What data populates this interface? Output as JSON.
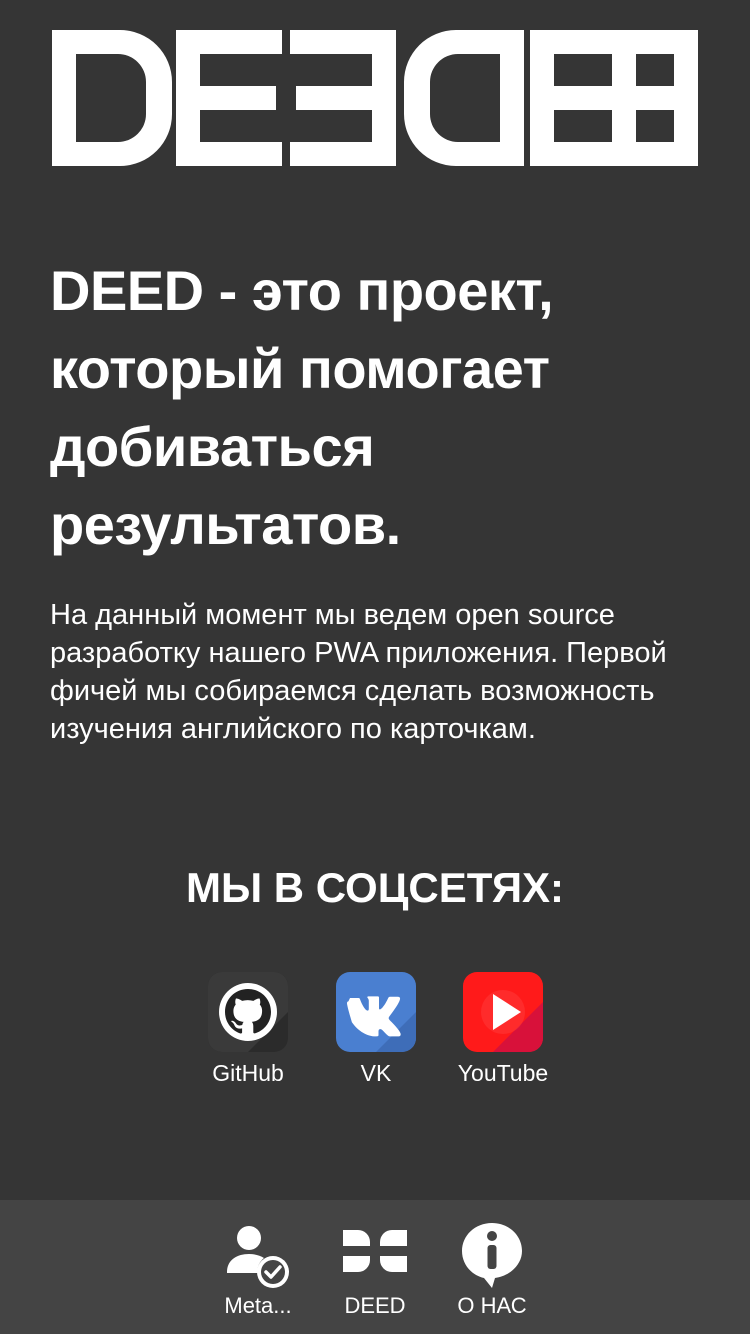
{
  "logo": {
    "text": "DEED",
    "color": "#ffffff"
  },
  "headline": "DEED - это проект, который помогает добиваться результатов.",
  "intro": "На данный момент мы ведем open source разработку нашего PWA приложения. Первой фичей мы собираемся сделать возможность изучения английского по карточкам.",
  "social_title": "МЫ В СОЦСЕТЯХ:",
  "socials": [
    {
      "label": "GitHub",
      "icon": "github-icon",
      "color": "#222222"
    },
    {
      "label": "VK",
      "icon": "vk-icon",
      "color": "#4a7fd0"
    },
    {
      "label": "YouTube",
      "icon": "youtube-icon",
      "color": "#ff1a1a"
    }
  ],
  "bottom_nav": [
    {
      "label": "Meta...",
      "icon": "user-check-icon"
    },
    {
      "label": "DEED",
      "icon": "deed-logo-icon"
    },
    {
      "label": "О НАС",
      "icon": "info-bubble-icon"
    }
  ],
  "colors": {
    "background": "#353535",
    "nav_background": "#444444",
    "text": "#ffffff"
  }
}
